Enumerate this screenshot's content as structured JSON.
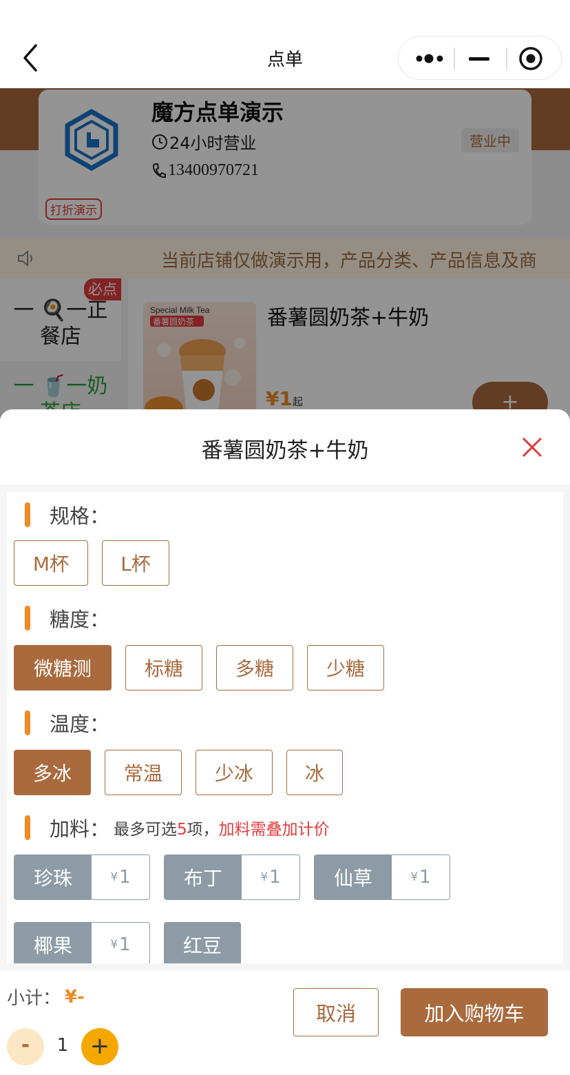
{
  "navbar": {
    "title": "点单"
  },
  "store": {
    "name": "魔方点单演示",
    "hours": "24小时营业",
    "phone": "13400970721",
    "status": "营业中",
    "discount_tag": "打折演示"
  },
  "notice": {
    "text": "当前店铺仅做演示用，产品分类、产品信息及商"
  },
  "categories": [
    {
      "line1": "一 🍳一正",
      "line2": "餐店",
      "badge": "必点"
    },
    {
      "line1": "一 🥤一奶",
      "line2": "茶店"
    }
  ],
  "goods": {
    "name": "番薯圆奶茶+牛奶",
    "price": "¥1",
    "price_suffix": "起",
    "add_label": "+",
    "img_label_en": "Special Milk Tea",
    "img_label_cn": "番薯圆奶茶"
  },
  "sheet": {
    "title": "番薯圆奶茶+牛奶",
    "sections": {
      "spec": {
        "title": "规格：",
        "options": [
          "M杯",
          "L杯"
        ],
        "selected": null
      },
      "sugar": {
        "title": "糖度：",
        "options": [
          "微糖测",
          "标糖",
          "多糖",
          "少糖"
        ],
        "selected": "微糖测"
      },
      "temp": {
        "title": "温度：",
        "options": [
          "多冰",
          "常温",
          "少冰",
          "冰"
        ],
        "selected": "多冰"
      },
      "addons": {
        "title": "加料：",
        "note_prefix": "最多可选",
        "note_num": "5",
        "note_unit": "项，",
        "note_red": "加料需叠加计价",
        "items": [
          {
            "name": "珍珠",
            "price": "1"
          },
          {
            "name": "布丁",
            "price": "1"
          },
          {
            "name": "仙草",
            "price": "1"
          },
          {
            "name": "椰果",
            "price": "1"
          },
          {
            "name": "红豆",
            "price": ""
          }
        ],
        "currency": "¥"
      }
    }
  },
  "footer": {
    "subtotal_label": "小计：",
    "subtotal_value": "¥-",
    "qty_minus": "-",
    "quantity": "1",
    "qty_plus": "+",
    "cancel_label": "取消",
    "add_to_cart_label": "加入购物车"
  },
  "colors": {
    "brand": "#a96a3d",
    "accent": "#f08a24",
    "danger": "#e23b3b",
    "addon": "#8d9ba6"
  }
}
